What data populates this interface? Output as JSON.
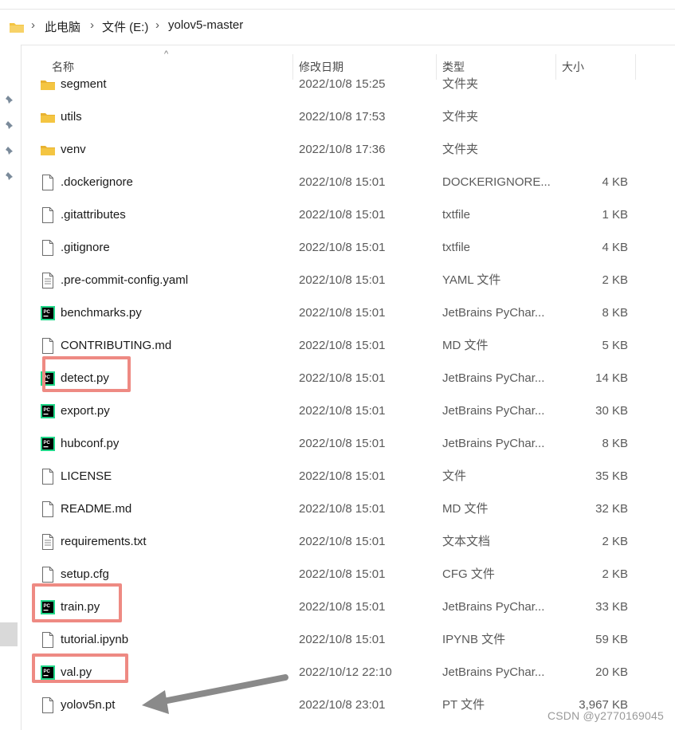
{
  "breadcrumb": {
    "items": [
      "此电脑",
      "文件 (E:)",
      "yolov5-master"
    ]
  },
  "columns": {
    "name": "名称",
    "date": "修改日期",
    "type": "类型",
    "size": "大小"
  },
  "files": [
    {
      "name": "segment",
      "date": "2022/10/8 15:25",
      "type": "文件夹",
      "size": "",
      "icon": "folder-icon"
    },
    {
      "name": "utils",
      "date": "2022/10/8 17:53",
      "type": "文件夹",
      "size": "",
      "icon": "folder-icon"
    },
    {
      "name": "venv",
      "date": "2022/10/8 17:36",
      "type": "文件夹",
      "size": "",
      "icon": "folder-icon"
    },
    {
      "name": ".dockerignore",
      "date": "2022/10/8 15:01",
      "type": "DOCKERIGNORE...",
      "size": "4 KB",
      "icon": "blank-file-icon"
    },
    {
      "name": ".gitattributes",
      "date": "2022/10/8 15:01",
      "type": "txtfile",
      "size": "1 KB",
      "icon": "blank-file-icon"
    },
    {
      "name": ".gitignore",
      "date": "2022/10/8 15:01",
      "type": "txtfile",
      "size": "4 KB",
      "icon": "blank-file-icon"
    },
    {
      "name": ".pre-commit-config.yaml",
      "date": "2022/10/8 15:01",
      "type": "YAML 文件",
      "size": "2 KB",
      "icon": "text-file-icon"
    },
    {
      "name": "benchmarks.py",
      "date": "2022/10/8 15:01",
      "type": "JetBrains PyChar...",
      "size": "8 KB",
      "icon": "pycharm-file-icon"
    },
    {
      "name": "CONTRIBUTING.md",
      "date": "2022/10/8 15:01",
      "type": "MD 文件",
      "size": "5 KB",
      "icon": "blank-file-icon"
    },
    {
      "name": "detect.py",
      "date": "2022/10/8 15:01",
      "type": "JetBrains PyChar...",
      "size": "14 KB",
      "icon": "pycharm-file-icon"
    },
    {
      "name": "export.py",
      "date": "2022/10/8 15:01",
      "type": "JetBrains PyChar...",
      "size": "30 KB",
      "icon": "pycharm-file-icon"
    },
    {
      "name": "hubconf.py",
      "date": "2022/10/8 15:01",
      "type": "JetBrains PyChar...",
      "size": "8 KB",
      "icon": "pycharm-file-icon"
    },
    {
      "name": "LICENSE",
      "date": "2022/10/8 15:01",
      "type": "文件",
      "size": "35 KB",
      "icon": "blank-file-icon"
    },
    {
      "name": "README.md",
      "date": "2022/10/8 15:01",
      "type": "MD 文件",
      "size": "32 KB",
      "icon": "blank-file-icon"
    },
    {
      "name": "requirements.txt",
      "date": "2022/10/8 15:01",
      "type": "文本文档",
      "size": "2 KB",
      "icon": "text-file-icon"
    },
    {
      "name": "setup.cfg",
      "date": "2022/10/8 15:01",
      "type": "CFG 文件",
      "size": "2 KB",
      "icon": "blank-file-icon"
    },
    {
      "name": "train.py",
      "date": "2022/10/8 15:01",
      "type": "JetBrains PyChar...",
      "size": "33 KB",
      "icon": "pycharm-file-icon"
    },
    {
      "name": "tutorial.ipynb",
      "date": "2022/10/8 15:01",
      "type": "IPYNB 文件",
      "size": "59 KB",
      "icon": "blank-file-icon"
    },
    {
      "name": "val.py",
      "date": "2022/10/12 22:10",
      "type": "JetBrains PyChar...",
      "size": "20 KB",
      "icon": "pycharm-file-icon"
    },
    {
      "name": "yolov5n.pt",
      "date": "2022/10/8 23:01",
      "type": "PT 文件",
      "size": "3,967 KB",
      "icon": "blank-file-icon"
    }
  ],
  "pycharm_badge": "PC",
  "colors": {
    "folder": "#f4c542",
    "highlight": "#ee8a83",
    "arrow": "#8a8a8a"
  },
  "watermark": "CSDN @y2770169045"
}
